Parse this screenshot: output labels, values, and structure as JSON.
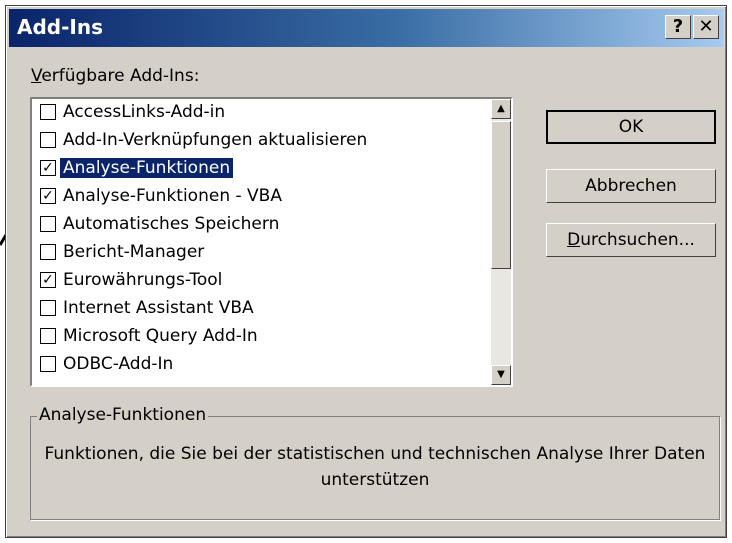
{
  "window": {
    "title": "Add-Ins",
    "help_label": "?",
    "close_label": "✕"
  },
  "list": {
    "label_prefix": "V",
    "label_rest": "erfügbare Add-Ins:",
    "items": [
      {
        "label": "AccessLinks-Add-in",
        "checked": false,
        "selected": false
      },
      {
        "label": "Add-In-Verknüpfungen aktualisieren",
        "checked": false,
        "selected": false
      },
      {
        "label": "Analyse-Funktionen",
        "checked": true,
        "selected": true
      },
      {
        "label": "Analyse-Funktionen - VBA",
        "checked": true,
        "selected": false
      },
      {
        "label": "Automatisches Speichern",
        "checked": false,
        "selected": false
      },
      {
        "label": "Bericht-Manager",
        "checked": false,
        "selected": false
      },
      {
        "label": "Eurowährungs-Tool",
        "checked": true,
        "selected": false
      },
      {
        "label": "Internet Assistant VBA",
        "checked": false,
        "selected": false
      },
      {
        "label": "Microsoft Query Add-In",
        "checked": false,
        "selected": false
      },
      {
        "label": "ODBC-Add-In",
        "checked": false,
        "selected": false
      }
    ],
    "check_glyph": "✓"
  },
  "buttons": {
    "ok": "OK",
    "cancel": "Abbrechen",
    "browse_prefix": "D",
    "browse_rest": "urchsuchen..."
  },
  "description": {
    "title": "Analyse-Funktionen",
    "text": "Funktionen, die Sie bei der statistischen und technischen Analyse Ihrer Daten unterstützen"
  },
  "icons": {
    "scroll_up": "▲",
    "scroll_down": "▼"
  }
}
